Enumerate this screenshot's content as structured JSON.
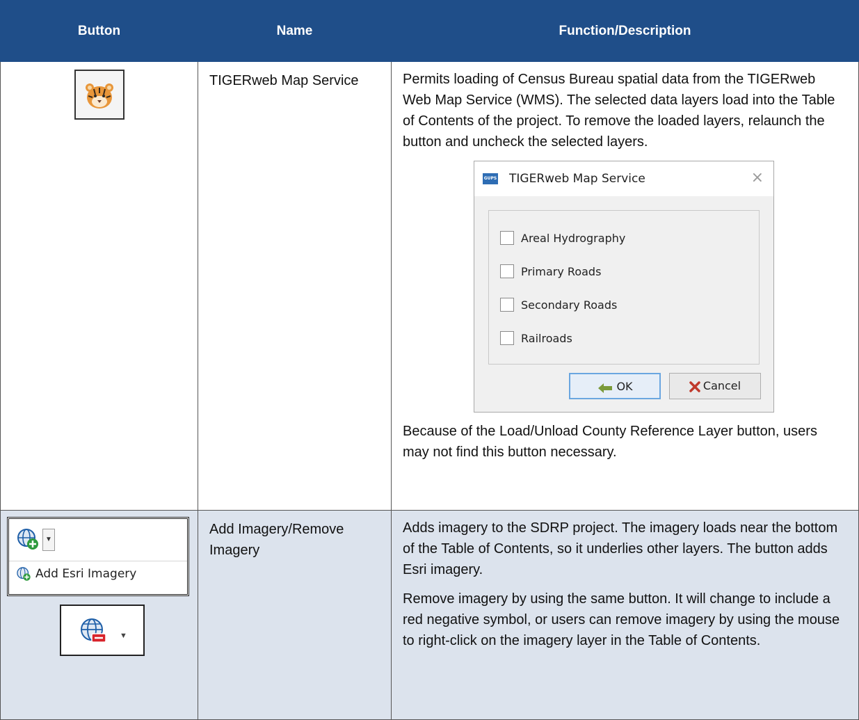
{
  "table": {
    "headers": {
      "button": "Button",
      "name": "Name",
      "description": "Function/Description"
    },
    "rows": [
      {
        "icon": "tiger-icon",
        "name": "TIGERweb Map Service",
        "description_1": "Permits loading of Census Bureau spatial data from the TIGERweb Web Map Service (WMS). The selected data layers load into the Table of Contents of the project. To remove the loaded layers, relaunch the button and uncheck the selected layers.",
        "description_2": "Because of the Load/Unload County Reference Layer button, users may not find this button necessary.",
        "dialog": {
          "app_icon_text": "GUPS",
          "title": "TIGERweb Map Service",
          "close": "×",
          "options": [
            "Areal Hydrography",
            "Primary Roads",
            "Secondary Roads",
            "Railroads"
          ],
          "ok_label": "OK",
          "cancel_label": "Cancel"
        }
      },
      {
        "icon": "globe-add-icon",
        "name": "Add Imagery/Remove Imagery",
        "menu_item": "Add Esri Imagery",
        "description_1": "Adds imagery to the SDRP project. The imagery loads near the bottom of the Table of Contents, so it underlies other layers. The button adds Esri imagery.",
        "description_2": "Remove imagery by using the same button. It will change to include a red negative symbol, or users can remove imagery by using the mouse to right-click on the imagery layer in the Table of Contents."
      }
    ]
  },
  "colors": {
    "header_bg": "#1f4e89",
    "row_shaded_bg": "#dce3ed"
  }
}
